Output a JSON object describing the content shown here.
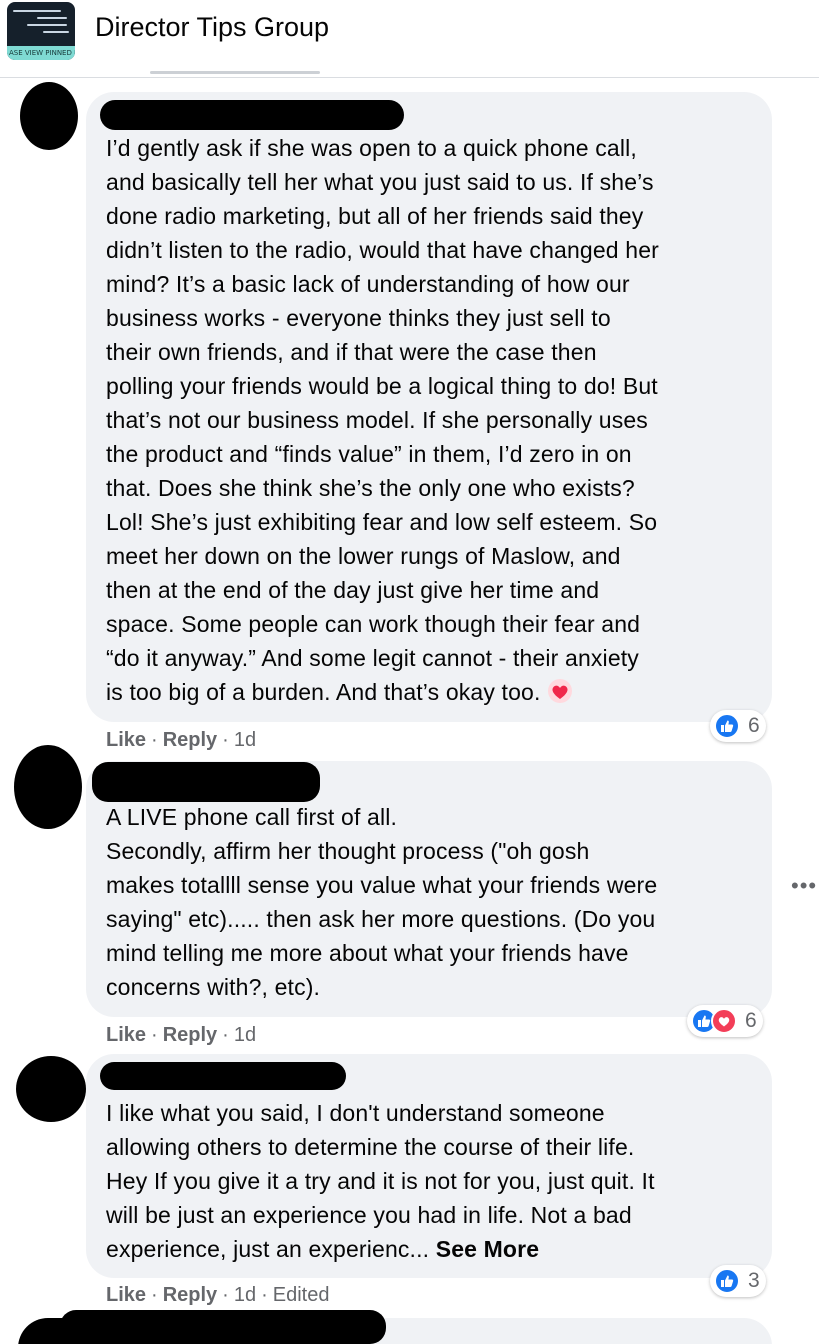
{
  "header": {
    "group_name": "Director Tips Group",
    "thumb_strip_text": "ASE VIEW PINNED P"
  },
  "comments": [
    {
      "lines": [
        "I’d gently ask if she was open to a quick phone call,",
        "and basically tell her what you just said to us. If she’s",
        "done radio marketing, but all of her friends said they",
        "didn’t listen to the radio, would that have changed her",
        "mind? It’s a basic lack of understanding of how our",
        "business works - everyone thinks they just sell to",
        "their own friends, and if that were the case then",
        "polling your friends would be a logical thing to do! But",
        "that’s not our business model. If she personally uses",
        "the product and “finds value” in them, I’d zero in on",
        "that. Does she think she’s the only one who exists?",
        "Lol! She’s just exhibiting fear and low self esteem. So",
        "meet her down on the lower rungs of Maslow, and",
        "then at the end of the day just give her time and",
        "space. Some people can work though their fear and",
        "“do it anyway.” And some legit cannot - their anxiety",
        "is too big of a burden. And that’s okay too."
      ],
      "emoji": "heart-emoji",
      "like_label": "Like",
      "reply_label": "Reply",
      "time": "1d",
      "reaction_count": "6",
      "reaction_types": [
        "like"
      ]
    },
    {
      "lines": [
        "A LIVE phone call first of all.",
        "Secondly, affirm her thought process (\"oh gosh",
        "makes totallll sense you value what your friends were",
        "saying\" etc)..... then ask her more questions. (Do you",
        "mind telling me more about what your friends have",
        "concerns with?, etc)."
      ],
      "like_label": "Like",
      "reply_label": "Reply",
      "time": "1d",
      "reaction_count": "6",
      "reaction_types": [
        "like",
        "love"
      ]
    },
    {
      "lines": [
        "I like what you said, I don't understand someone",
        "allowing others to determine the course of their life.",
        "Hey If you give it a try and it is not for you, just quit. It",
        "will be just an experience you had in life. Not a bad",
        "experience, just an experienc..."
      ],
      "see_more": "See More",
      "like_label": "Like",
      "reply_label": "Reply",
      "time": "1d",
      "edited": "Edited",
      "reaction_count": "3",
      "reaction_types": [
        "like"
      ]
    }
  ],
  "colors": {
    "bubble": "#f0f2f5",
    "like_blue": "#1877f2",
    "love_red": "#f33e58",
    "meta_gray": "#65676b"
  },
  "icons": {
    "like": "thumbs-up-icon",
    "love": "heart-icon",
    "more": "more-options-icon"
  }
}
